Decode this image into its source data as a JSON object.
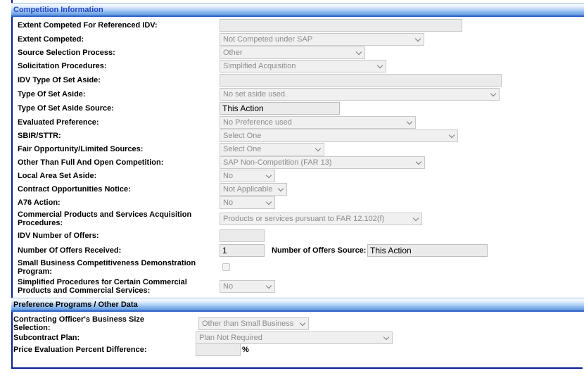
{
  "sections": {
    "competition": "Competition Information",
    "preference": "Preference Programs / Other Data"
  },
  "fields": {
    "extent_competed_idv": {
      "label": "Extent Competed For Referenced IDV:",
      "value": ""
    },
    "extent_competed": {
      "label": "Extent Competed:",
      "value": "Not Competed under SAP"
    },
    "source_selection": {
      "label": "Source Selection Process:",
      "value": "Other"
    },
    "solicitation_procedures": {
      "label": "Solicitation Procedures:",
      "value": "Simplified Acquisition"
    },
    "idv_type_set_aside": {
      "label": "IDV Type Of Set Aside:",
      "value": ""
    },
    "type_set_aside": {
      "label": "Type Of Set Aside:",
      "value": "No set aside used."
    },
    "type_set_aside_source": {
      "label": "Type Of Set Aside Source:",
      "value": "This Action"
    },
    "evaluated_preference": {
      "label": "Evaluated Preference:",
      "value": "No Preference used"
    },
    "sbir_sttr": {
      "label": "SBIR/STTR:",
      "value": "Select One"
    },
    "fair_opportunity": {
      "label": "Fair Opportunity/Limited Sources:",
      "value": "Select One"
    },
    "other_than_full": {
      "label": "Other Than Full And Open Competition:",
      "value": "SAP Non-Competition (FAR 13)"
    },
    "local_area": {
      "label": "Local Area Set Aside:",
      "value": "No"
    },
    "contract_opportunities": {
      "label": "Contract Opportunities Notice:",
      "value": "Not Applicable"
    },
    "a76_action": {
      "label": "A76 Action:",
      "value": "No"
    },
    "commercial_products": {
      "label_line1": "Commercial Products and Services Acquisition",
      "label_line2": "Procedures:",
      "value": "Products or services pursuant to FAR 12.102(f)"
    },
    "idv_number_offers": {
      "label": "IDV Number of Offers:",
      "value": ""
    },
    "number_offers": {
      "label": "Number Of Offers Received:",
      "value": "1"
    },
    "offers_source": {
      "label": "Number of Offers Source:",
      "value": "This Action"
    },
    "small_business_demo": {
      "label_line1": "Small Business Competitiveness Demonstration",
      "label_line2": "Program:",
      "checked": false
    },
    "simplified_procedures": {
      "label_line1": "Simplified Procedures for Certain Commercial",
      "label_line2": "Products and Commercial Services:",
      "value": "No"
    },
    "business_size": {
      "label_line1": "Contracting Officer's Business Size",
      "label_line2": "Selection:",
      "value": "Other than Small Business"
    },
    "subcontract_plan": {
      "label": "Subcontract Plan:",
      "value": "Plan Not Required"
    },
    "price_evaluation": {
      "label": "Price Evaluation Percent Difference:",
      "value": "",
      "unit": "%"
    }
  }
}
